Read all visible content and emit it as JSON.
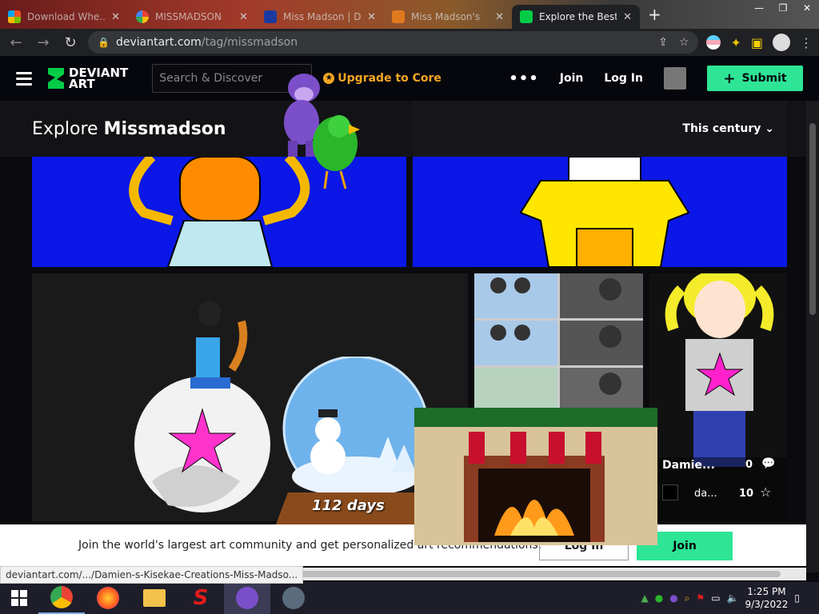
{
  "browser": {
    "tabs": [
      {
        "title": "Download Whe...",
        "active": false,
        "color": "#2b5aa8"
      },
      {
        "title": "MISSMADSON",
        "active": false,
        "color": "#ffffff"
      },
      {
        "title": "Miss Madson | D",
        "active": false,
        "color": "#1b3aa0"
      },
      {
        "title": "Miss Madson's",
        "active": false,
        "color": "#e07a1f"
      },
      {
        "title": "Explore the Best",
        "active": true,
        "color": "#05cc47"
      }
    ],
    "url_host": "deviantart.com",
    "url_path": "/tag/missmadson",
    "status_url": "deviantart.com/.../Damien-s-Kisekae-Creations-Miss-Madso..."
  },
  "header": {
    "logo_line1": "DEVIANT",
    "logo_line2": "ART",
    "search_placeholder": "Search & Discover",
    "upgrade_label": "Upgrade to Core",
    "more_label": "•••",
    "join_label": "Join",
    "login_label": "Log In",
    "submit_label": "Submit"
  },
  "explore": {
    "prefix": "Explore",
    "tag": "Missmadson",
    "sort_label": "This century"
  },
  "card": {
    "title": "Damie...",
    "comments": "0",
    "author": "da...",
    "favorites": "10"
  },
  "overlay": {
    "days_label": "112 days"
  },
  "join_banner": {
    "text": "Join the world's largest art community and get personalized art recommendations.",
    "login_label": "Log In",
    "join_label": "Join"
  },
  "taskbar": {
    "time": "1:25 PM",
    "date": "9/3/2022"
  },
  "colors": {
    "accent": "#2ee596",
    "upgrade": "#f5a623",
    "tile_blue": "#0a17e6"
  }
}
